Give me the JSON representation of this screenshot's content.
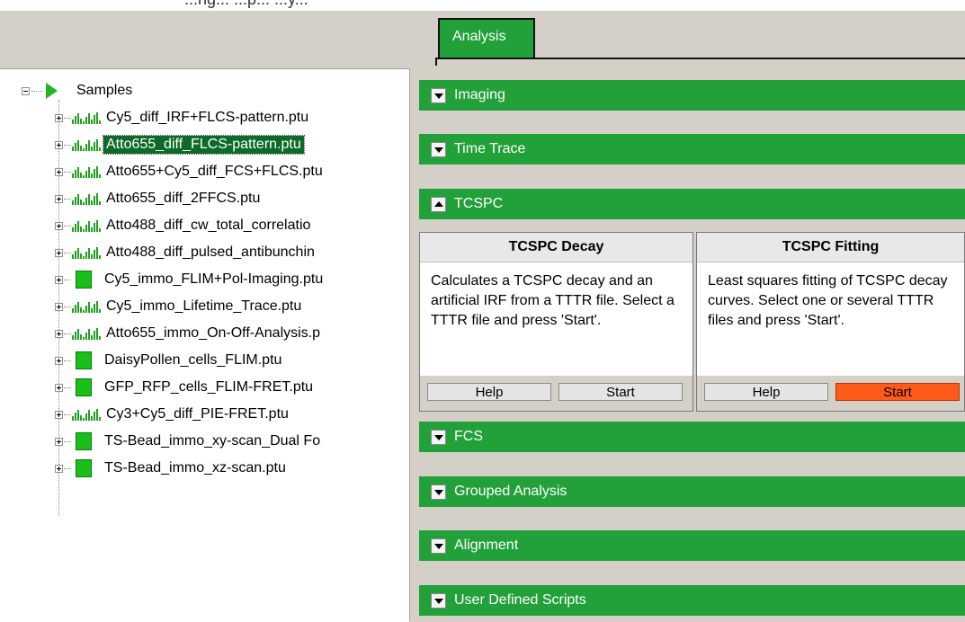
{
  "window": {
    "cut_title": "...ng... ...p... ...y..."
  },
  "tabs": [
    {
      "label": "Analysis",
      "active": true
    }
  ],
  "tree": {
    "root": {
      "label": "Samples",
      "icon": "play-icon",
      "color": "#22b522"
    },
    "items": [
      {
        "label": "Cy5_diff_IRF+FLCS-pattern.ptu",
        "icon": "bars-icon"
      },
      {
        "label": "Atto655_diff_FLCS-pattern.ptu",
        "icon": "bars-icon",
        "selected": true
      },
      {
        "label": "Atto655+Cy5_diff_FCS+FLCS.ptu",
        "icon": "bars-icon"
      },
      {
        "label": "Atto655_diff_2FFCS.ptu",
        "icon": "bars-icon"
      },
      {
        "label": "Atto488_diff_cw_total_correlatio",
        "icon": "bars-icon"
      },
      {
        "label": "Atto488_diff_pulsed_antibunchin",
        "icon": "bars-icon"
      },
      {
        "label": "Cy5_immo_FLIM+Pol-Imaging.ptu",
        "icon": "square-icon"
      },
      {
        "label": "Cy5_immo_Lifetime_Trace.ptu",
        "icon": "bars-icon"
      },
      {
        "label": "Atto655_immo_On-Off-Analysis.p",
        "icon": "bars-icon"
      },
      {
        "label": "DaisyPollen_cells_FLIM.ptu",
        "icon": "square-icon"
      },
      {
        "label": "GFP_RFP_cells_FLIM-FRET.ptu",
        "icon": "square-icon"
      },
      {
        "label": "Cy3+Cy5_diff_PIE-FRET.ptu",
        "icon": "bars-icon"
      },
      {
        "label": "TS-Bead_immo_xy-scan_Dual Fo",
        "icon": "square-icon"
      },
      {
        "label": "TS-Bead_immo_xz-scan.ptu",
        "icon": "square-icon"
      }
    ]
  },
  "accordion": {
    "sections": [
      {
        "label": "Imaging",
        "expanded": false
      },
      {
        "label": "Time Trace",
        "expanded": false
      },
      {
        "label": "TCSPC",
        "expanded": true
      },
      {
        "label": "FCS",
        "expanded": false
      },
      {
        "label": "Grouped Analysis",
        "expanded": false
      },
      {
        "label": "Alignment",
        "expanded": false
      },
      {
        "label": "User Defined Scripts",
        "expanded": false
      }
    ],
    "tcspc_cards": [
      {
        "title": "TCSPC Decay",
        "description": "Calculates a TCSPC decay and an artificial IRF from a TTTR file. Select a TTTR file and press 'Start'.",
        "help_label": "Help",
        "start_label": "Start"
      },
      {
        "title": "TCSPC Fitting",
        "description": "Least squares fitting of TCSPC decay curves. Select one or several TTTR files and press 'Start'.",
        "help_label": "Help",
        "start_label": "Start"
      }
    ]
  },
  "colors": {
    "accent_green": "#22a039",
    "selection": "#0d6b2a",
    "start_highlight": "#ff5a1a"
  }
}
